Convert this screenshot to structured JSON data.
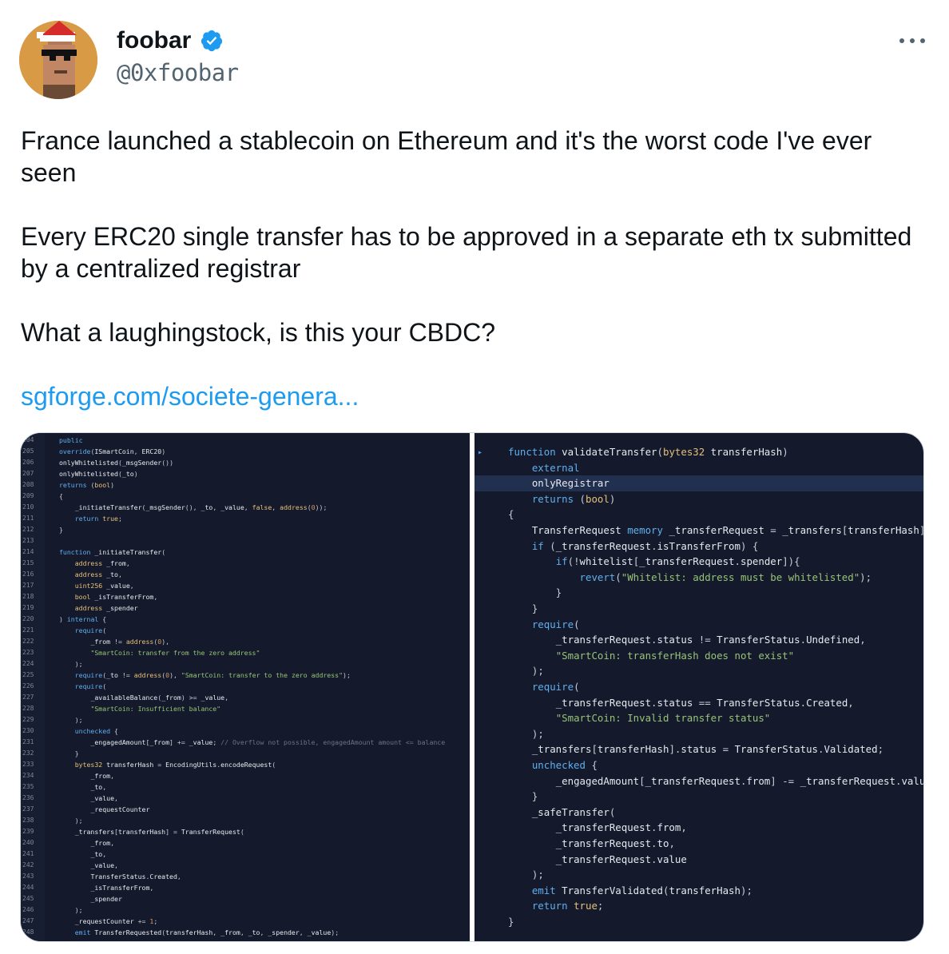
{
  "author": {
    "display_name": "foobar",
    "handle": "@0xfoobar",
    "verified_icon": "verified-badge-icon",
    "more_icon": "more-options-icon"
  },
  "tweet": {
    "line1": "France launched a stablecoin on Ethereum and it's the worst code I've ever seen",
    "line2": "Every ERC20 single transfer has to be approved in a separate eth tx submitted by a centralized registrar",
    "line3": "What a laughingstock, is this your CBDC?",
    "link": "sgforge.com/societe-genera..."
  },
  "colors": {
    "link": "#1d9bf0",
    "verified": "#1d9bf0",
    "code_bg": "#141a2b"
  },
  "code_left": [
    {
      "n": "204",
      "t": "public"
    },
    {
      "n": "205",
      "t": "override(ISmartCoin, ERC20)"
    },
    {
      "n": "206",
      "t": "onlyWhitelisted(_msgSender())"
    },
    {
      "n": "207",
      "t": "onlyWhitelisted(_to)"
    },
    {
      "n": "208",
      "t": "returns (bool)"
    },
    {
      "n": "209",
      "t": "{"
    },
    {
      "n": "210",
      "t": "    _initiateTransfer(_msgSender(), _to, _value, false, address(0));"
    },
    {
      "n": "211",
      "t": "    return true;"
    },
    {
      "n": "212",
      "t": "}"
    },
    {
      "n": "213",
      "t": ""
    },
    {
      "n": "214",
      "t": "function _initiateTransfer("
    },
    {
      "n": "215",
      "t": "    address _from,"
    },
    {
      "n": "216",
      "t": "    address _to,"
    },
    {
      "n": "217",
      "t": "    uint256 _value,"
    },
    {
      "n": "218",
      "t": "    bool _isTransferFrom,"
    },
    {
      "n": "219",
      "t": "    address _spender"
    },
    {
      "n": "220",
      "t": ") internal {"
    },
    {
      "n": "221",
      "t": "    require("
    },
    {
      "n": "222",
      "t": "        _from != address(0),"
    },
    {
      "n": "223",
      "t": "        \"SmartCoin: transfer from the zero address\""
    },
    {
      "n": "224",
      "t": "    );"
    },
    {
      "n": "225",
      "t": "    require(_to != address(0), \"SmartCoin: transfer to the zero address\");"
    },
    {
      "n": "226",
      "t": "    require("
    },
    {
      "n": "227",
      "t": "        _availableBalance(_from) >= _value,"
    },
    {
      "n": "228",
      "t": "        \"SmartCoin: Insufficient balance\""
    },
    {
      "n": "229",
      "t": "    );"
    },
    {
      "n": "230",
      "t": "    unchecked {"
    },
    {
      "n": "231",
      "t": "        _engagedAmount[_from] += _value; // Overflow not possible, engagedAmount amount <= balance"
    },
    {
      "n": "232",
      "t": "    }"
    },
    {
      "n": "233",
      "t": "    bytes32 transferHash = EncodingUtils.encodeRequest("
    },
    {
      "n": "234",
      "t": "        _from,"
    },
    {
      "n": "235",
      "t": "        _to,"
    },
    {
      "n": "236",
      "t": "        _value,"
    },
    {
      "n": "237",
      "t": "        _requestCounter"
    },
    {
      "n": "238",
      "t": "    );"
    },
    {
      "n": "239",
      "t": "    _transfers[transferHash] = TransferRequest("
    },
    {
      "n": "240",
      "t": "        _from,"
    },
    {
      "n": "241",
      "t": "        _to,"
    },
    {
      "n": "242",
      "t": "        _value,"
    },
    {
      "n": "243",
      "t": "        TransferStatus.Created,"
    },
    {
      "n": "244",
      "t": "        _isTransferFrom,"
    },
    {
      "n": "245",
      "t": "        _spender"
    },
    {
      "n": "246",
      "t": "    );"
    },
    {
      "n": "247",
      "t": "    _requestCounter += 1;"
    },
    {
      "n": "248",
      "t": "    emit TransferRequested(transferHash, _from, _to, _spender, _value);"
    }
  ],
  "code_right": [
    "function validateTransfer(bytes32 transferHash)",
    "    external",
    "    onlyRegistrar",
    "    returns (bool)",
    "{",
    "    TransferRequest memory _transferRequest = _transfers[transferHash];",
    "    if (_transferRequest.isTransferFrom) {",
    "        if(!whitelist[_transferRequest.spender]){",
    "            revert(\"Whitelist: address must be whitelisted\");",
    "        }",
    "    }",
    "    require(",
    "        _transferRequest.status != TransferStatus.Undefined,",
    "        \"SmartCoin: transferHash does not exist\"",
    "    );",
    "    require(",
    "        _transferRequest.status == TransferStatus.Created,",
    "        \"SmartCoin: Invalid transfer status\"",
    "    );",
    "    _transfers[transferHash].status = TransferStatus.Validated;",
    "    unchecked {",
    "        _engagedAmount[_transferRequest.from] -= _transferRequest.value;",
    "    }",
    "    _safeTransfer(",
    "        _transferRequest.from,",
    "        _transferRequest.to,",
    "        _transferRequest.value",
    "    );",
    "    emit TransferValidated(transferHash);",
    "    return true;",
    "}"
  ]
}
